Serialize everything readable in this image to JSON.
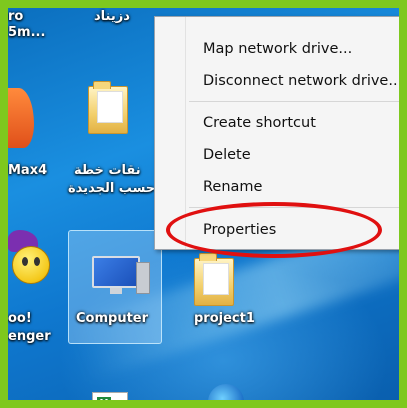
{
  "desktop": {
    "icons": {
      "top_left_line1": "ro",
      "top_left_line2": "5m...",
      "top_arabic": "دزيناد",
      "max_label": "Max4",
      "folder_label_line1": "نقات خطة",
      "folder_label_line2": "حسب الجديدة",
      "yahoo_line1": "oo!",
      "yahoo_line2": "enger",
      "computer_label": "Computer",
      "project_label": "project1"
    }
  },
  "context_menu": {
    "items": [
      {
        "label": "Map network drive..."
      },
      {
        "label": "Disconnect network drive..."
      },
      {
        "label": "Create shortcut"
      },
      {
        "label": "Delete"
      },
      {
        "label": "Rename"
      },
      {
        "label": "Properties"
      }
    ]
  },
  "colors": {
    "frame_border": "#7ec81e",
    "highlight_ellipse": "#e01010"
  }
}
